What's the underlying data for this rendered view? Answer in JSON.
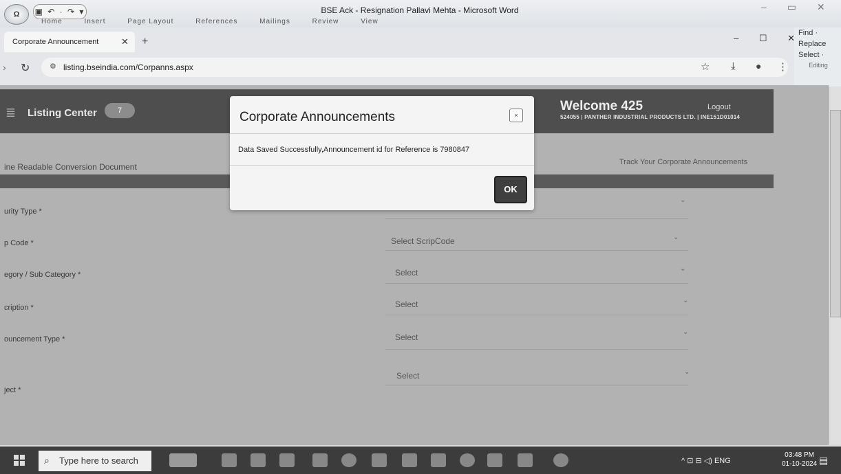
{
  "word": {
    "office_button": "Ω",
    "quick_access": "▣ ↶ · ↷ ▾",
    "title": "BSE Ack - Resignation Pallavi Mehta - Microsoft Word",
    "ribbon_tabs": [
      "Home",
      "Insert",
      "Page Layout",
      "References",
      "Mailings",
      "Review",
      "View"
    ],
    "edit_panel": {
      "find": "Find ·",
      "replace": "Replace",
      "select": "Select ·",
      "group": "Editing"
    }
  },
  "browser": {
    "tab_title": "Corporate Announcement",
    "url": "listing.bseindia.com/Corpanns.aspx"
  },
  "site": {
    "brand": "Listing Center",
    "badge": "7",
    "welcome": "Welcome 425",
    "logout": "Logout",
    "company_line": "524055 | PANTHER INDUSTRIAL PRODUCTS LTD. | INE151D01014",
    "doc_link": "ine Readable Conversion Document",
    "track_link": "Track Your Corporate Announcements"
  },
  "form": {
    "fields": [
      {
        "label": "urity Type *",
        "value": ""
      },
      {
        "label": "p Code *",
        "value": "Select ScripCode"
      },
      {
        "label": "egory / Sub Category *",
        "value": "Select"
      },
      {
        "label": "cription *",
        "value": "Select"
      },
      {
        "label": "ouncement Type *",
        "value": "Select"
      },
      {
        "label": "ject *",
        "value": "Select"
      }
    ]
  },
  "modal": {
    "title": "Corporate Announcements",
    "close": "×",
    "message": "Data Saved Successfully,Announcement id for Reference is 7980847",
    "ok": "OK"
  },
  "taskbar": {
    "search_placeholder": "Type here to search",
    "tray": "^ ⊡ ⊟ ◁) ENG",
    "time": "03:48 PM",
    "date": "01-10-2024"
  }
}
